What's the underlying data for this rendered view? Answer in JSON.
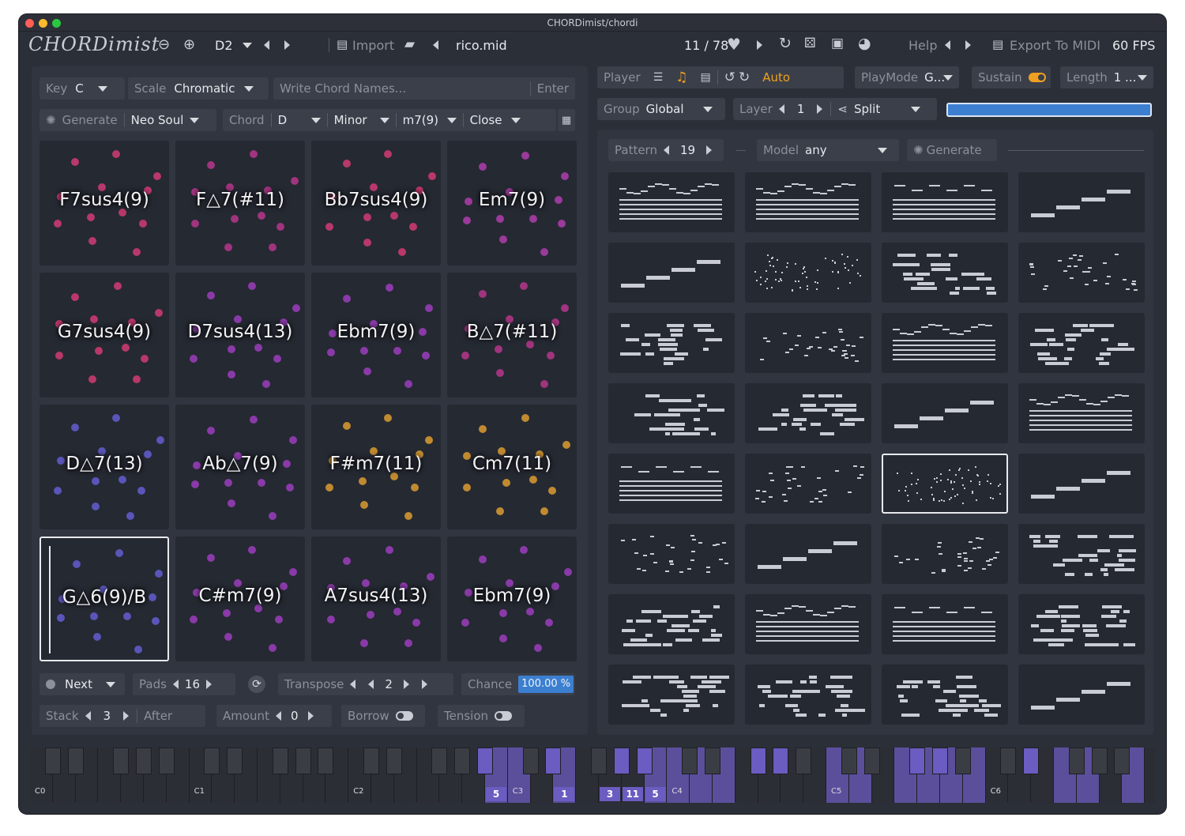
{
  "window": {
    "title": "CHORDimist/chordi"
  },
  "topbar": {
    "logo": "CHORDimist",
    "octave": "D2",
    "import_label": "Import",
    "file_name": "rico.mid",
    "counter": "11 / 78",
    "help_label": "Help",
    "export_label": "Export To MIDI",
    "fps": "60 FPS"
  },
  "left": {
    "key_label": "Key",
    "key_value": "C",
    "scale_label": "Scale",
    "scale_value": "Chromatic",
    "chord_names_placeholder": "Write Chord Names...",
    "enter_label": "Enter",
    "generate_label": "Generate",
    "style_value": "Neo Soul",
    "chord_label": "Chord",
    "chord_root": "D",
    "chord_quality": "Minor",
    "chord_ext": "m7(9)",
    "voicing": "Close",
    "pads": [
      {
        "name": "F7sus4(9)",
        "color": "#b8386a"
      },
      {
        "name": "F△7(#11)",
        "color": "#a0347e"
      },
      {
        "name": "Bb7sus4(9)",
        "color": "#b8386a"
      },
      {
        "name": "Em7(9)",
        "color": "#9a3a9a"
      },
      {
        "name": "G7sus4(9)",
        "color": "#b8386a"
      },
      {
        "name": "D7sus4(13)",
        "color": "#8a3aa8"
      },
      {
        "name": "Ebm7(9)",
        "color": "#8a3aa8"
      },
      {
        "name": "B△7(#11)",
        "color": "#a0347e"
      },
      {
        "name": "D△7(13)",
        "color": "#5a55b8"
      },
      {
        "name": "Ab△7(9)",
        "color": "#8a3aa8"
      },
      {
        "name": "F#m7(11)",
        "color": "#c08a30"
      },
      {
        "name": "Cm7(11)",
        "color": "#c08a30"
      },
      {
        "name": "G△6(9)/B",
        "color": "#5a55b8"
      },
      {
        "name": "C#m7(9)",
        "color": "#8a3aa8"
      },
      {
        "name": "A7sus4(13)",
        "color": "#8a3aa8"
      },
      {
        "name": "Ebm7(9)",
        "color": "#8a3aa8"
      }
    ],
    "next_label": "Next",
    "pads_label": "Pads",
    "pads_value": "16",
    "transpose_label": "Transpose",
    "transpose_value": "2",
    "chance_label": "Chance",
    "chance_value": "100.00 %",
    "stack_label": "Stack",
    "stack_value": "3",
    "after_label": "After",
    "amount_label": "Amount",
    "amount_value": "0",
    "borrow_label": "Borrow",
    "tension_label": "Tension"
  },
  "right": {
    "player_label": "Player",
    "auto_label": "Auto",
    "playmode_label": "PlayMode",
    "playmode_value": "G...",
    "sustain_label": "Sustain",
    "length_label": "Length",
    "length_value": "1 ...",
    "group_label": "Group",
    "group_value": "Global",
    "layer_label": "Layer",
    "layer_value": "1",
    "split_label": "Split",
    "pattern_label": "Pattern",
    "pattern_value": "19",
    "model_label": "Model",
    "model_value": "any",
    "generate_label": "Generate"
  },
  "keyboard": {
    "octaves": [
      "C0",
      "C1",
      "C2",
      "C3",
      "C4",
      "C5",
      "C6"
    ],
    "active_numbers": [
      "5",
      "1",
      "3",
      "11",
      "5"
    ]
  },
  "colors": {
    "accent": "#f0a020",
    "chance_bg": "#3c7fd0",
    "selected_border": "#e8eaee",
    "key_active": "#5b4f9c"
  }
}
